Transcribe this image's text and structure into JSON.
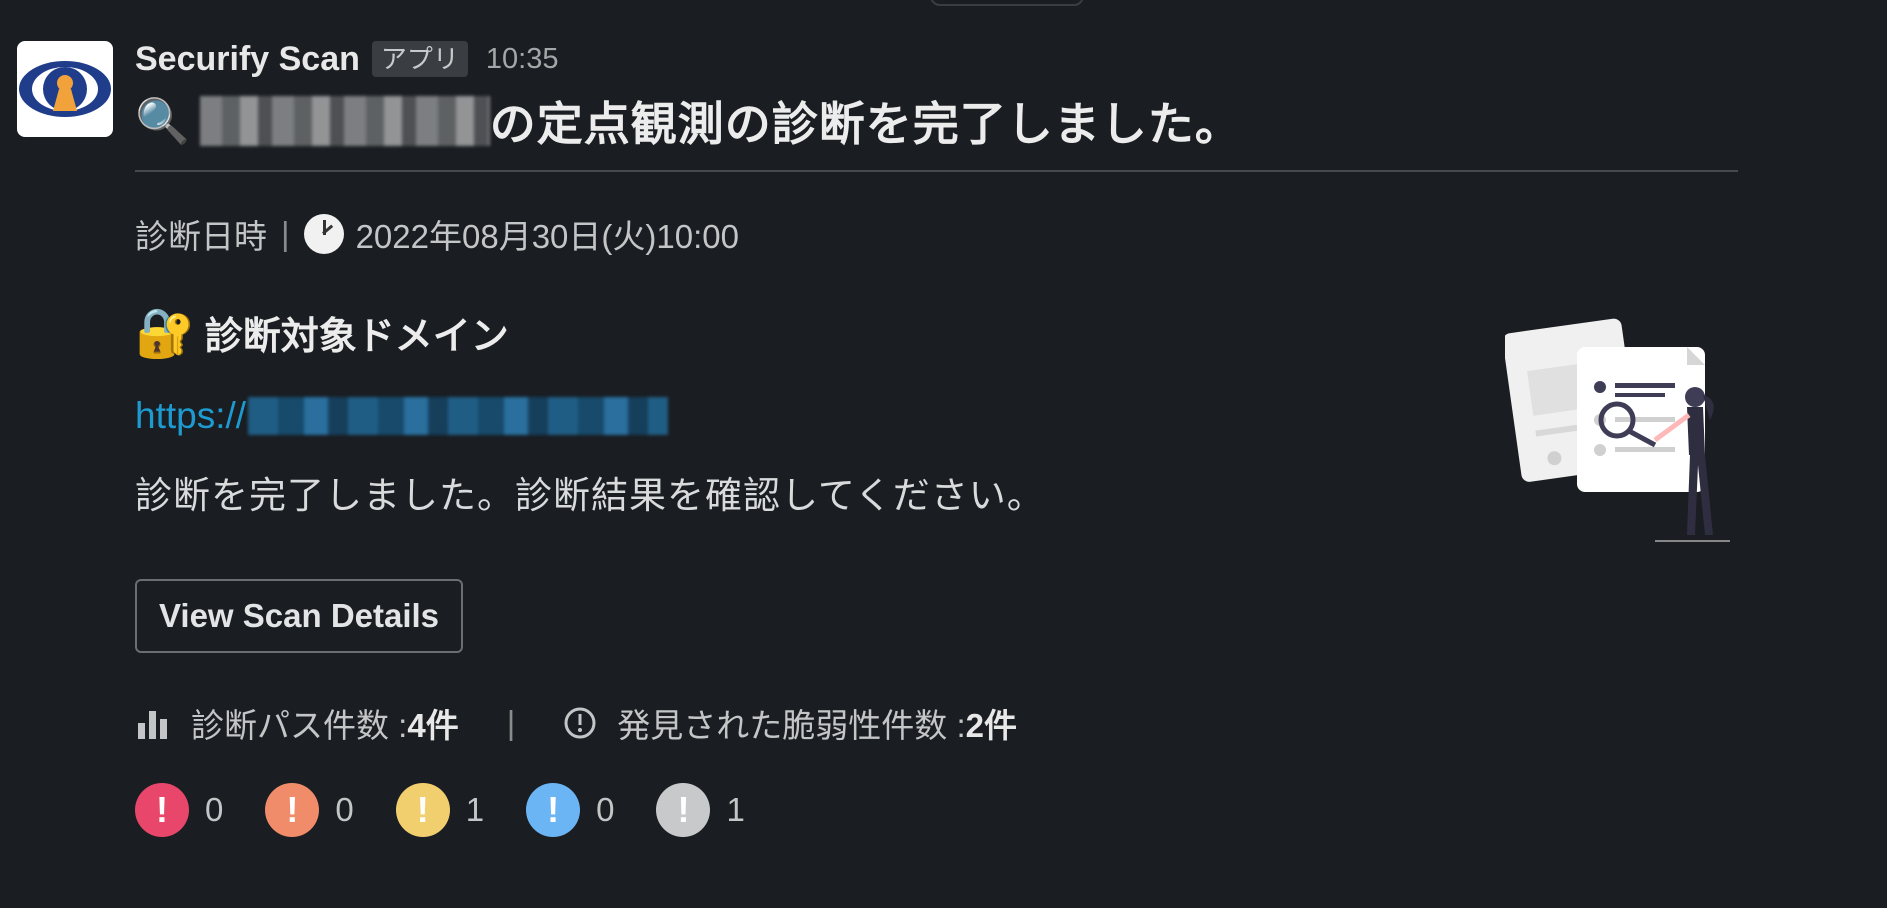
{
  "message": {
    "app_name": "Securify Scan",
    "app_badge": "アプリ",
    "time": "10:35",
    "title_suffix": "の定点観測の診断を完了しました。",
    "date_label": "診断日時",
    "date_sep": "|",
    "date_value": "2022年08月30日(火)10:00",
    "domain_heading": "診断対象ドメイン",
    "url_prefix": "https://",
    "description": "診断を完了しました。診断結果を確認してください。",
    "button_label": "View Scan Details"
  },
  "stats": {
    "paths_label": "診断パス件数 : ",
    "paths_value": "4件",
    "separator": "|",
    "vulns_label": "発見された脆弱性件数 : ",
    "vulns_value": "2件"
  },
  "severities": [
    {
      "name": "critical",
      "color": "#e8466a",
      "count": "0"
    },
    {
      "name": "high",
      "color": "#f08c6a",
      "count": "0"
    },
    {
      "name": "medium",
      "color": "#f2cf6e",
      "count": "1"
    },
    {
      "name": "low",
      "color": "#6cb5f5",
      "count": "0"
    },
    {
      "name": "info",
      "color": "#c8c9ca",
      "count": "1"
    }
  ],
  "icons": {
    "title": "magnifying-glass-icon",
    "clock": "clock-icon",
    "lock": "lock-with-key-icon",
    "paths": "bar-chart-icon",
    "vulns": "info-circle-icon"
  }
}
